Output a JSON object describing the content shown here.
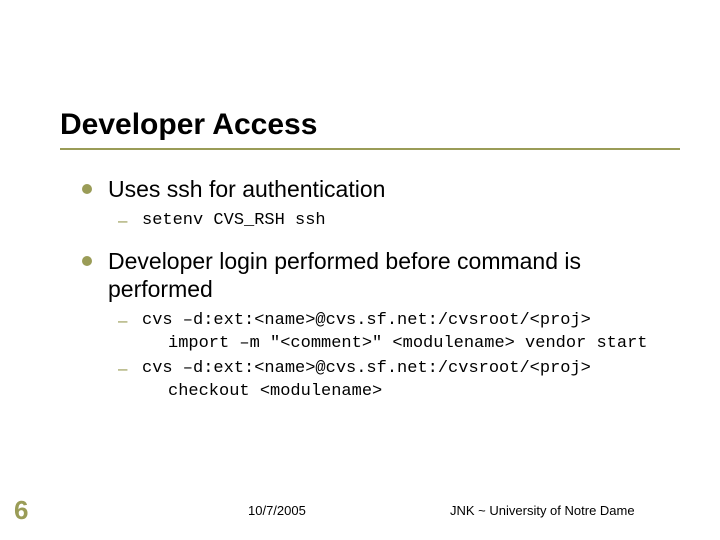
{
  "title": "Developer Access",
  "bullets": [
    {
      "text": "Uses ssh for authentication",
      "sub": [
        {
          "lines": [
            "setenv CVS_RSH ssh"
          ]
        }
      ]
    },
    {
      "text": "Developer login performed before command is performed",
      "sub": [
        {
          "lines": [
            "cvs –d:ext:<name>@cvs.sf.net:/cvsroot/<proj>",
            "import –m \"<comment>\" <modulename> vendor start"
          ]
        },
        {
          "lines": [
            "cvs –d:ext:<name>@cvs.sf.net:/cvsroot/<proj>",
            "checkout <modulename>"
          ]
        }
      ]
    }
  ],
  "footer": {
    "page": "6",
    "date": "10/7/2005",
    "affiliation": "JNK ~ University of Notre Dame"
  }
}
